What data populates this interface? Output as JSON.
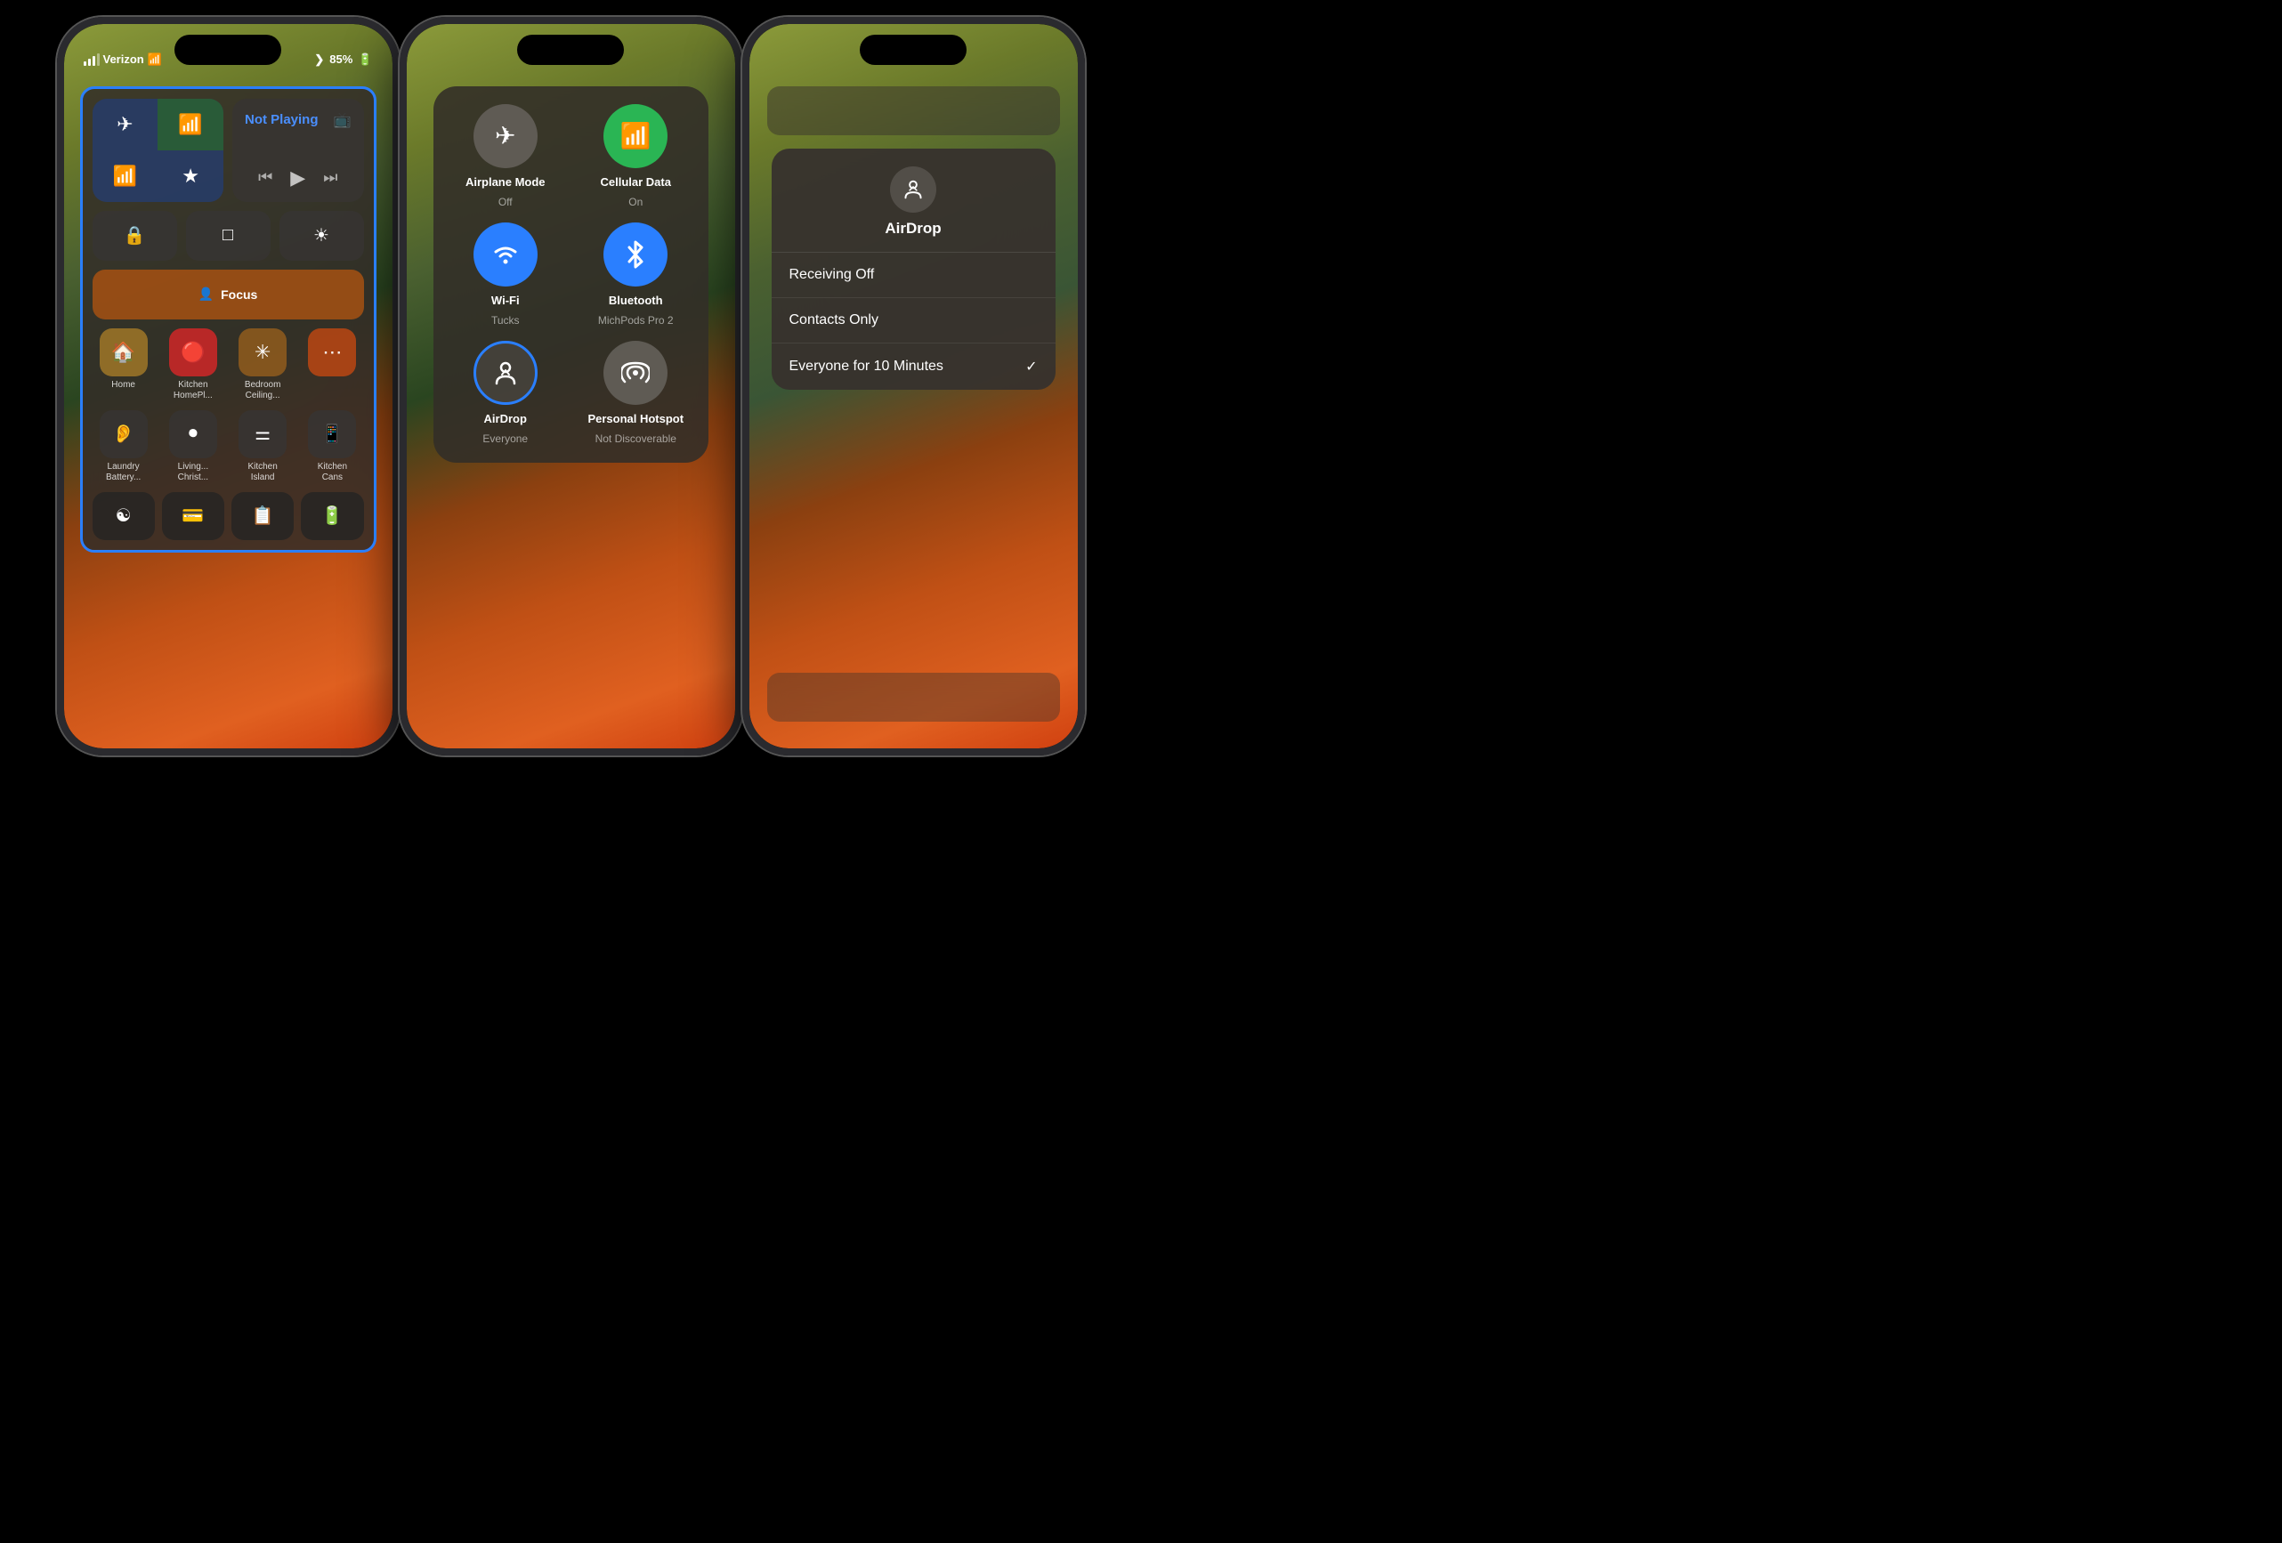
{
  "phones": {
    "phone1": {
      "status": {
        "carrier": "Verizon",
        "battery": "85%"
      },
      "connectivity": {
        "airplane": "✈",
        "cellular": "📶",
        "wifi": "wifi",
        "bluetooth": "bluetooth"
      },
      "media": {
        "title": "Not Playing"
      },
      "focus": {
        "label": "Focus"
      },
      "home_items": [
        {
          "label": "Home",
          "icon": "🏠"
        },
        {
          "label": "Kitchen\nHomePl...",
          "icon": "🍳"
        },
        {
          "label": "Bedroom\nCeiling...",
          "icon": "💡"
        },
        {
          "label": "",
          "icon": "🔧"
        }
      ],
      "battery_items": [
        {
          "label": "Laundry\nBattery..."
        },
        {
          "label": "Living...\nChrist..."
        },
        {
          "label": "Kitchen\nIsland"
        },
        {
          "label": "Kitchen\nCans"
        }
      ]
    },
    "phone2": {
      "grid_items": [
        {
          "label": "Airplane Mode",
          "sublabel": "Off",
          "icon": "✈"
        },
        {
          "label": "Cellular Data",
          "sublabel": "On",
          "icon": "📶"
        },
        {
          "label": "Wi-Fi",
          "sublabel": "Tucks",
          "icon": "wifi"
        },
        {
          "label": "Bluetooth",
          "sublabel": "MichPods Pro 2",
          "icon": "bluetooth"
        },
        {
          "label": "AirDrop",
          "sublabel": "Everyone",
          "icon": "airdrop"
        },
        {
          "label": "Personal Hotspot",
          "sublabel": "Not Discoverable",
          "icon": "🔗"
        }
      ]
    },
    "phone3": {
      "airdrop": {
        "title": "AirDrop",
        "options": [
          {
            "label": "Receiving Off",
            "selected": false
          },
          {
            "label": "Contacts Only",
            "selected": false
          },
          {
            "label": "Everyone for 10 Minutes",
            "selected": true
          }
        ]
      }
    }
  }
}
